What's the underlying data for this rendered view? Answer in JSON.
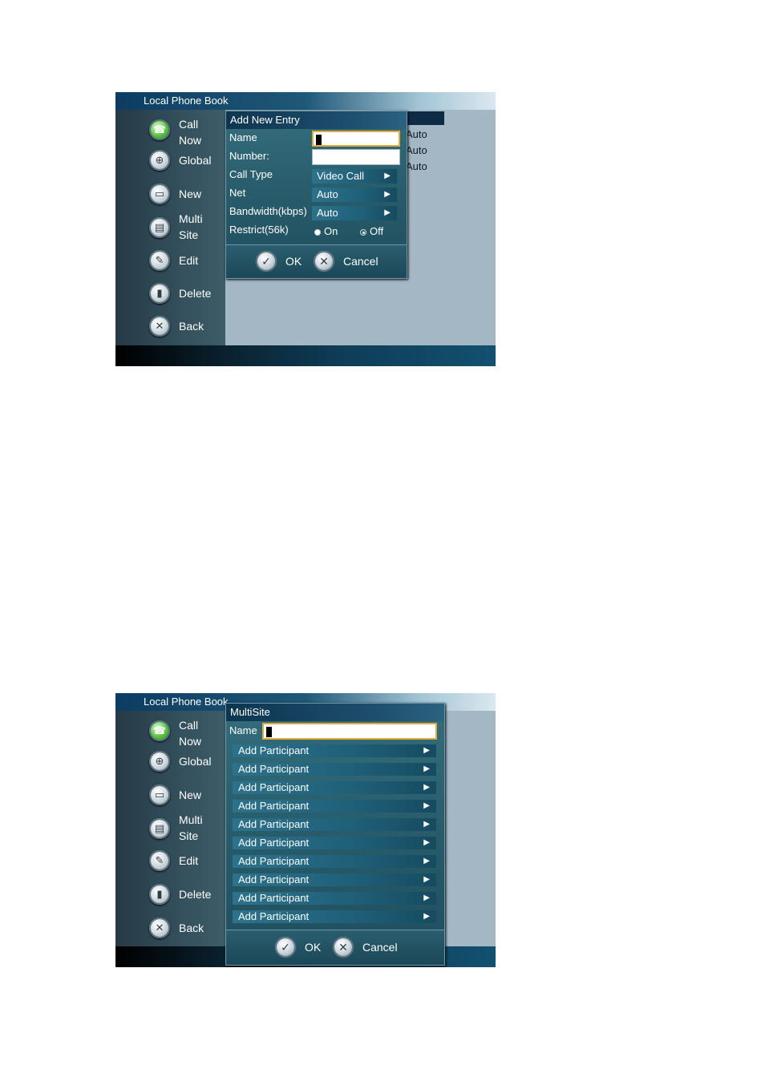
{
  "app_title": "Local Phone Book",
  "nav": [
    {
      "label_line1": "Call",
      "label_line2": "Now",
      "icon": "phone-icon"
    },
    {
      "label_line1": "Global",
      "label_line2": "",
      "icon": "globe-icon"
    },
    {
      "label_line1": "New",
      "label_line2": "",
      "icon": "new-entry-icon"
    },
    {
      "label_line1": "Multi",
      "label_line2": "Site",
      "icon": "multisite-icon"
    },
    {
      "label_line1": "Edit",
      "label_line2": "",
      "icon": "pencil-icon"
    },
    {
      "label_line1": "Delete",
      "label_line2": "",
      "icon": "trash-icon"
    },
    {
      "label_line1": "Back",
      "label_line2": "",
      "icon": "back-icon"
    }
  ],
  "background_values": [
    "Auto",
    "Auto",
    "Auto"
  ],
  "add_entry": {
    "title": "Add New Entry",
    "name_label": "Name",
    "number_label": "Number:",
    "call_type_label": "Call Type",
    "call_type_value": "Video Call",
    "net_label": "Net",
    "net_value": "Auto",
    "bandwidth_label": "Bandwidth(kbps)",
    "bandwidth_value": "Auto",
    "restrict_label": "Restrict(56k)",
    "restrict_on": "On",
    "restrict_off": "Off",
    "ok_label": "OK",
    "cancel_label": "Cancel"
  },
  "multisite": {
    "title": "MultiSite",
    "name_label": "Name",
    "participants": [
      "Add Participant",
      "Add Participant",
      "Add Participant",
      "Add Participant",
      "Add Participant",
      "Add Participant",
      "Add Participant",
      "Add Participant",
      "Add Participant",
      "Add Participant"
    ],
    "ok_label": "OK",
    "cancel_label": "Cancel"
  },
  "colors": {
    "sidebar": "#33505c",
    "content": "#a3b7c4",
    "dialog": "#2a5f6e",
    "field_focus_border": "#e6a93a"
  }
}
